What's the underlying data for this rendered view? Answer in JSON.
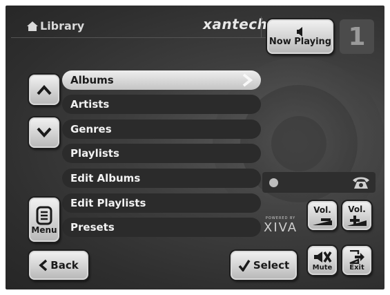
{
  "header": {
    "title": "Library",
    "title_icon": "home-icon",
    "brand": "xantech"
  },
  "now_playing": {
    "label": "Now Playing",
    "icon": "speaker-icon"
  },
  "zone_number": "1",
  "list": {
    "items": [
      {
        "label": "Albums",
        "selected": true
      },
      {
        "label": "Artists"
      },
      {
        "label": "Genres"
      },
      {
        "label": "Playlists"
      },
      {
        "label": "Edit Albums"
      },
      {
        "label": "Edit Playlists"
      },
      {
        "label": "Presets"
      }
    ]
  },
  "nav": {
    "up_icon": "chevron-up-icon",
    "down_icon": "chevron-down-icon",
    "menu_label": "Menu",
    "back_label": "Back",
    "select_label": "Select"
  },
  "powered_by": {
    "small": "POWERED BY",
    "logo": "XIVA"
  },
  "controls": {
    "vol_down_label": "Vol.",
    "vol_up_label": "Vol.",
    "mute_label": "Mute",
    "exit_label": "Exit"
  },
  "colors": {
    "background": "#3a3a3a",
    "button": "#d8d8d8",
    "list_item": "#2b2b2b",
    "selected_item": "#e6e6e6"
  }
}
